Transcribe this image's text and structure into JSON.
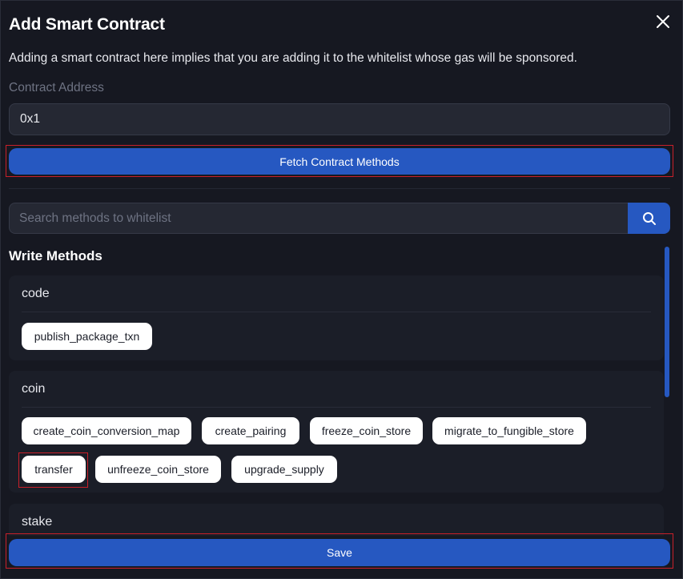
{
  "modal": {
    "title": "Add Smart Contract",
    "close_icon": "close-icon",
    "description": "Adding a smart contract here implies that you are adding it to the whitelist whose gas will be sponsored."
  },
  "contract": {
    "label": "Contract Address",
    "value": "0x1",
    "fetch_label": "Fetch Contract Methods"
  },
  "search": {
    "placeholder": "Search methods to whitelist",
    "icon": "search-icon"
  },
  "write_methods": {
    "title": "Write Methods",
    "groups": [
      {
        "name": "code",
        "methods": [
          "publish_package_txn"
        ]
      },
      {
        "name": "coin",
        "methods": [
          "create_coin_conversion_map",
          "create_pairing",
          "freeze_coin_store",
          "migrate_to_fungible_store",
          "transfer",
          "unfreeze_coin_store",
          "upgrade_supply"
        ]
      },
      {
        "name": "stake",
        "methods": []
      }
    ]
  },
  "footer": {
    "save_label": "Save"
  },
  "colors": {
    "background": "#161821",
    "accent": "#2658c1",
    "highlight": "#c8202a",
    "chip": "#ffffff"
  }
}
